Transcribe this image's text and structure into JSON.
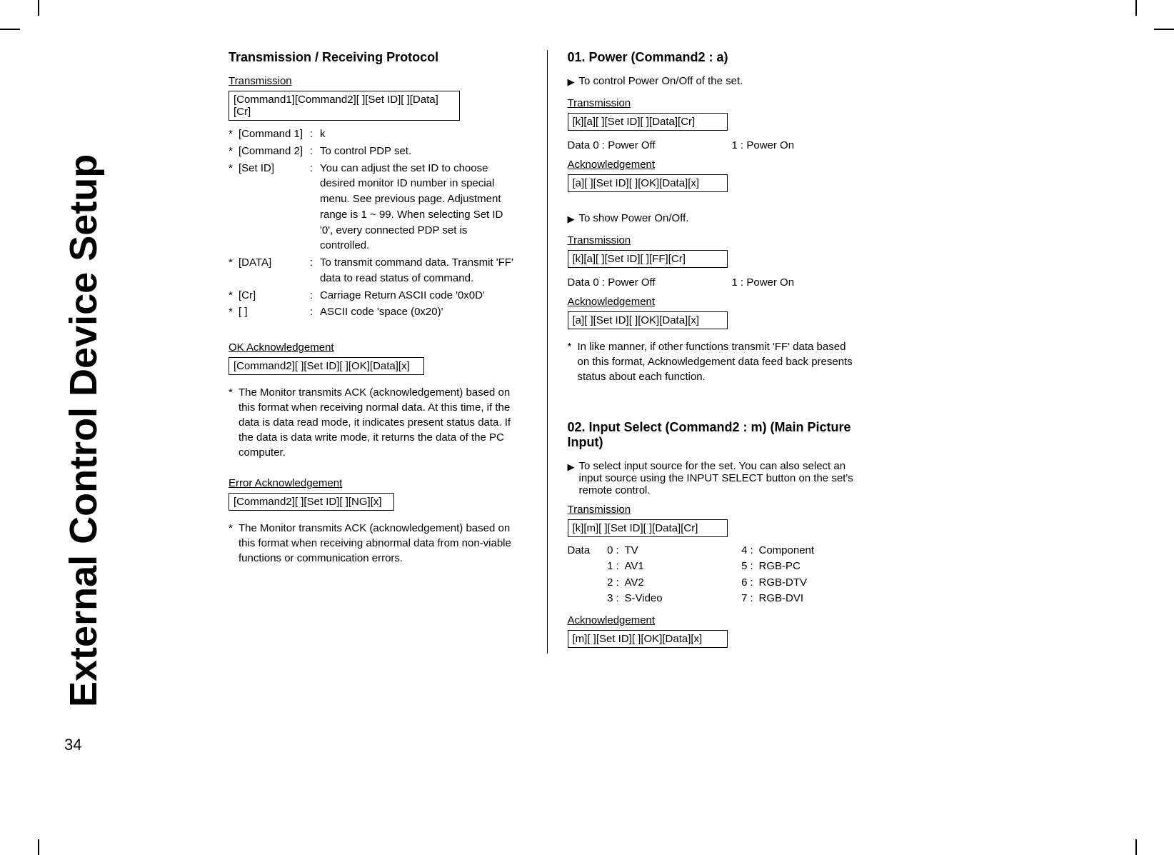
{
  "pageTitle": "External Control Device Setup",
  "pageNumber": "34",
  "left": {
    "heading": "Transmission / Receiving Protocol",
    "transmission": {
      "label": "Transmission",
      "box": "[Command1][Command2][  ][Set ID][  ][Data][Cr]"
    },
    "defs": [
      {
        "key": "[Command 1]",
        "val": "k"
      },
      {
        "key": "[Command 2]",
        "val": "To control PDP set."
      },
      {
        "key": "[Set ID]",
        "val": "You can adjust the set ID to choose desired monitor ID number in special menu. See previous page. Adjustment range is 1 ~ 99. When selecting Set ID '0', every connected PDP set is controlled."
      },
      {
        "key": "[DATA]",
        "val": "To transmit command data. Transmit 'FF' data to read status of command."
      },
      {
        "key": "[Cr]",
        "val": "Carriage Return ASCII code '0x0D'"
      },
      {
        "key": "[    ]",
        "val": "ASCII code 'space (0x20)'"
      }
    ],
    "okAck": {
      "label": "OK Acknowledgement",
      "box": "[Command2][  ][Set ID][  ][OK][Data][x]",
      "note": "The Monitor transmits ACK (acknowledgement) based on this format when receiving normal data. At this time, if the data is data read mode, it indicates present status data. If the data is data write mode, it returns the data of the PC computer."
    },
    "errAck": {
      "label": "Error Acknowledgement",
      "box": "[Command2][  ][Set ID][  ][NG][x]",
      "note": "The Monitor transmits ACK (acknowledgement) based on this format when receiving abnormal data from non-viable functions or communication errors."
    }
  },
  "right": {
    "power": {
      "heading": "01. Power (Command2 : a)",
      "desc1": "To control Power On/Off of the set.",
      "trans1Label": "Transmission",
      "trans1Box": "[k][a][  ][Set ID][  ][Data][Cr]",
      "data1Left": "Data  0  : Power Off",
      "data1Right": "1  : Power On",
      "ack1Label": "Acknowledgement",
      "ack1Box": "[a][  ][Set ID][  ][OK][Data][x]",
      "desc2": "To show Power On/Off.",
      "trans2Label": "Transmission",
      "trans2Box": "[k][a][  ][Set ID][  ][FF][Cr]",
      "data2Left": "Data  0  : Power Off",
      "data2Right": "1  : Power On",
      "ack2Label": "Acknowledgement",
      "ack2Box": "[a][  ][Set ID][  ][OK][Data][x]",
      "note": "In like manner, if other functions transmit 'FF' data based on this format, Acknowledgement data feed back presents status about each function."
    },
    "input": {
      "heading": "02. Input Select (Command2 : m) (Main Picture Input)",
      "desc": "To select input source for the set. You can also select an input source using the INPUT SELECT button on the set's remote control.",
      "transLabel": "Transmission",
      "transBox": "[k][m][  ][Set ID][  ][Data][Cr]",
      "dataPrefix": "Data",
      "dataRows": [
        {
          "n1": "0",
          "l1": "TV",
          "n2": "4",
          "l2": "Component"
        },
        {
          "n1": "1",
          "l1": "AV1",
          "n2": "5",
          "l2": "RGB-PC"
        },
        {
          "n1": "2",
          "l1": "AV2",
          "n2": "6",
          "l2": "RGB-DTV"
        },
        {
          "n1": "3",
          "l1": "S-Video",
          "n2": "7",
          "l2": "RGB-DVI"
        }
      ],
      "ackLabel": "Acknowledgement",
      "ackBox": "[m][  ][Set ID][  ][OK][Data][x]"
    }
  }
}
